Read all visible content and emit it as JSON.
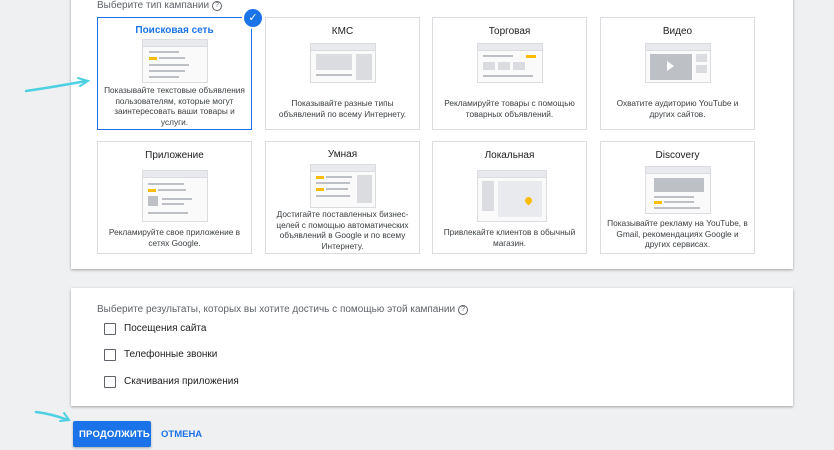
{
  "campaign_type": {
    "label": "Выберите тип кампании",
    "help_icon": "?",
    "selected_check": "✓",
    "tiles": [
      {
        "id": "search",
        "title": "Поисковая сеть",
        "desc": "Показывайте текстовые объявления пользователям, которые могут заинтересовать ваши товары и услуги.",
        "selected": true
      },
      {
        "id": "kms",
        "title": "КМС",
        "desc": "Показывайте разные типы объявлений по всему Интернету."
      },
      {
        "id": "shopping",
        "title": "Торговая",
        "desc": "Рекламируйте товары с помощью товарных объявлений."
      },
      {
        "id": "video",
        "title": "Видео",
        "desc": "Охватите аудиторию YouTube и других сайтов."
      },
      {
        "id": "app",
        "title": "Приложение",
        "desc": "Рекламируйте свое приложение в сетях Google."
      },
      {
        "id": "smart",
        "title": "Умная",
        "desc": "Достигайте поставленных бизнес-целей с помощью автоматических объявлений в Google и по всему Интернету."
      },
      {
        "id": "local",
        "title": "Локальная",
        "desc": "Привлекайте клиентов в обычный магазин."
      },
      {
        "id": "discovery",
        "title": "Discovery",
        "desc": "Показывайте рекламу на YouTube, в Gmail, рекомендациях Google и других сервисах."
      }
    ]
  },
  "goals": {
    "label": "Выберите результаты, которых вы хотите достичь с помощью этой кампании",
    "help_icon": "?",
    "options": [
      {
        "label": "Посещения сайта",
        "checked": false
      },
      {
        "label": "Телефонные звонки",
        "checked": false
      },
      {
        "label": "Скачивания приложения",
        "checked": false
      }
    ]
  },
  "actions": {
    "continue_label": "ПРОДОЛЖИТЬ",
    "cancel_label": "ОТМЕНА"
  },
  "colors": {
    "accent": "#1a73e8",
    "highlight": "#fbbc04",
    "annotation_arrow": "#4dd0e1"
  }
}
